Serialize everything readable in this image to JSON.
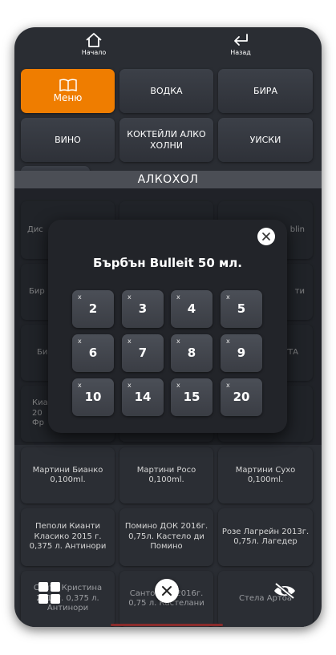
{
  "topbar": {
    "home_label": "Начало",
    "back_label": "Назад"
  },
  "categories": [
    {
      "label": "Меню",
      "active": true
    },
    {
      "label": "ВОДКА"
    },
    {
      "label": "БИРА"
    },
    {
      "label": "ВИНО"
    },
    {
      "label": "КОКТЕЙЛИ АЛКО ХОЛНИ"
    },
    {
      "label": "УИСКИ"
    }
  ],
  "section_title": "АЛКОХОЛ",
  "products_visible": {
    "row1_left": "Дис",
    "row1_right": "blin",
    "row2_left": "Бир",
    "row2_right": "ти",
    "row3_left": "Би",
    "row3_right": "УТА",
    "row4_left": "Киа 20 Фр",
    "martini_bianco": "Мартини Бианко 0,100ml.",
    "martini_rosso": "Мартини Росо 0,100ml.",
    "martini_dry": "Мартини Сухо 0,100ml.",
    "chianti": "Пеполи Кианти Класико 2015 г. 0,375 л. Антинори",
    "pomino": "Помино ДОК 2016г. 0,75л. Кастело ди Помино",
    "rose": "Розе Лагрейн 2013г. 0,75л. Лагедер",
    "bottom_left": "Санта Кристина 2016г. 0,375 л. Антинори",
    "bottom_mid": "Санто ИГТ 2016г. 0,75 л. Кастелани",
    "bottom_right": "Стела Артоа"
  },
  "modal": {
    "title": "Бърбън Bulleit 50 мл.",
    "multiplier_symbol": "x",
    "quantities": [
      "2",
      "3",
      "4",
      "5",
      "6",
      "7",
      "8",
      "9",
      "10",
      "14",
      "15",
      "20"
    ]
  },
  "colors": {
    "accent": "#ef7d00",
    "background": "#2a2d33",
    "tile": "#3c4048"
  },
  "icons": [
    "home-icon",
    "back-arrow-icon",
    "book-icon",
    "close-icon",
    "grid-icon",
    "eye-off-icon"
  ]
}
